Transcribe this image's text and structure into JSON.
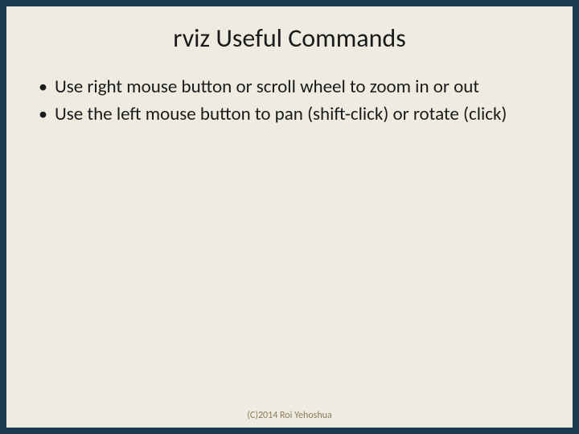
{
  "slide": {
    "title": "rviz Useful Commands",
    "bullets": [
      "Use right mouse button or scroll wheel to zoom in or out",
      "Use the left mouse button to pan (shift-click) or rotate (click)"
    ],
    "footer": "(C)2014 Roi Yehoshua"
  }
}
